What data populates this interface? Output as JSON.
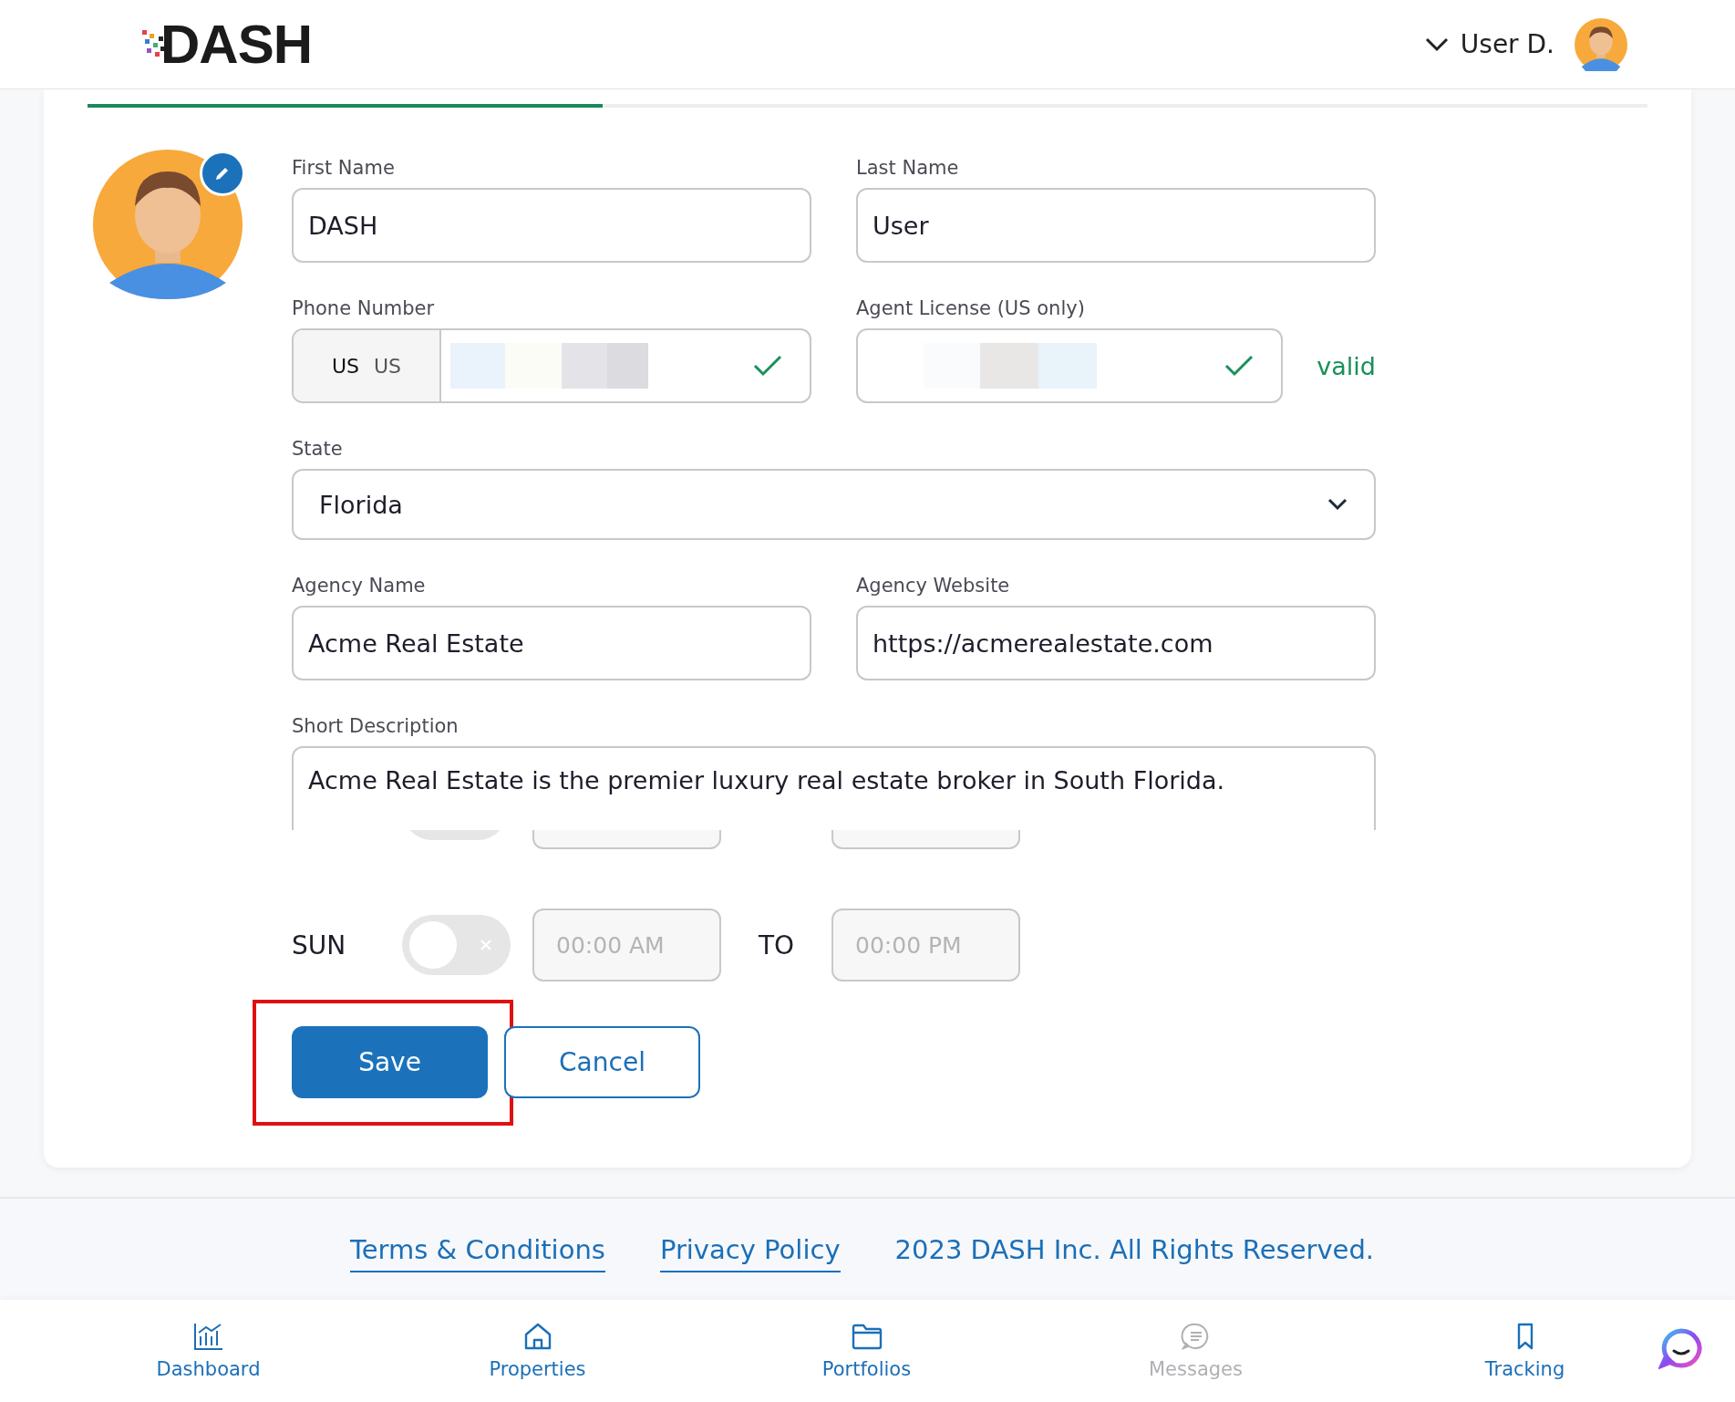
{
  "header": {
    "logo": "DASH",
    "user_name": "User D."
  },
  "tab_progress": {
    "level": 0.33
  },
  "fields": [
    {
      "kind": "text",
      "label": "First Name",
      "value": "DASH"
    },
    {
      "kind": "text",
      "label": "Last Name",
      "value": "User"
    },
    {
      "kind": "phone",
      "label": "Phone Number",
      "country_code": "US",
      "country_name": "US",
      "valid": true
    },
    {
      "kind": "license",
      "label": "Agent License (US only)",
      "valid": true,
      "status_text": "valid"
    },
    {
      "kind": "select",
      "label": "State",
      "value": "Florida"
    },
    {
      "kind": "text",
      "label": "Agency Name",
      "value": "Acme Real Estate"
    },
    {
      "kind": "text",
      "label": "Agency Website",
      "value": "https://acmerealestate.com"
    },
    {
      "kind": "textarea",
      "label": "Short Description",
      "value": "Acme Real Estate is the premier luxury real estate broker in South Florida."
    }
  ],
  "covered_row": {
    "enabled": false
  },
  "schedule": [
    {
      "day": "SUN",
      "enabled": false,
      "from_placeholder": "00:00 AM",
      "to_label": "TO",
      "to_placeholder": "00:00 PM"
    }
  ],
  "actions": [
    {
      "label": "Save",
      "kind": "primary",
      "highlighted": true
    },
    {
      "label": "Cancel",
      "kind": "secondary",
      "highlighted": false
    }
  ],
  "footer": {
    "links": [
      "Terms & Conditions",
      "Privacy Policy"
    ],
    "copyright": "2023 DASH Inc. All Rights Reserved."
  },
  "nav": [
    {
      "label": "Dashboard",
      "kind": "chart",
      "disabled": false
    },
    {
      "label": "Properties",
      "kind": "home",
      "disabled": false
    },
    {
      "label": "Portfolios",
      "kind": "folder",
      "disabled": false
    },
    {
      "label": "Messages",
      "kind": "message",
      "disabled": true
    },
    {
      "label": "Tracking",
      "kind": "bookmark",
      "disabled": false
    }
  ]
}
